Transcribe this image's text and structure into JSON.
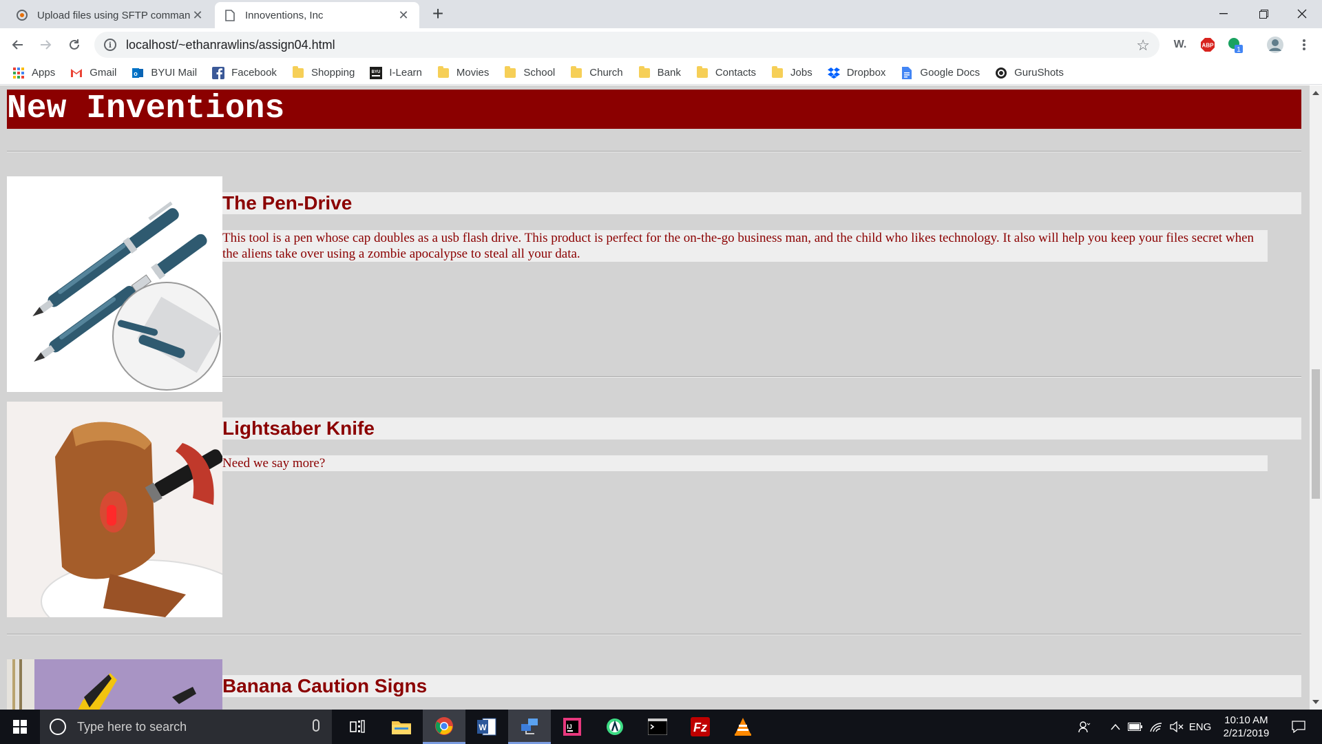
{
  "browser": {
    "tabs": [
      {
        "title": "Upload files using SFTP comman",
        "active": false,
        "icon": "sftp-favicon"
      },
      {
        "title": "Innoventions, Inc",
        "active": true,
        "icon": "page-icon"
      }
    ],
    "new_tab_label": "+",
    "url": "localhost/~ethanrawlins/assign04.html",
    "extensions": [
      "w-extension-icon",
      "adblock-plus-icon",
      "green-extension-icon",
      "profile-avatar"
    ],
    "extension_labels": {
      "w": "W.",
      "abp": "ABP",
      "badge": "1"
    },
    "window_controls": [
      "minimize",
      "restore",
      "close"
    ]
  },
  "bookmarks": [
    {
      "label": "Apps",
      "icon": "apps-grid-icon"
    },
    {
      "label": "Gmail",
      "icon": "gmail-icon"
    },
    {
      "label": "BYUI Mail",
      "icon": "outlook-icon"
    },
    {
      "label": "Facebook",
      "icon": "facebook-icon"
    },
    {
      "label": "Shopping",
      "icon": "folder-icon"
    },
    {
      "label": "I-Learn",
      "icon": "byui-icon"
    },
    {
      "label": "Movies",
      "icon": "folder-icon"
    },
    {
      "label": "School",
      "icon": "folder-icon"
    },
    {
      "label": "Church",
      "icon": "folder-icon"
    },
    {
      "label": "Bank",
      "icon": "folder-icon"
    },
    {
      "label": "Contacts",
      "icon": "folder-icon"
    },
    {
      "label": "Jobs",
      "icon": "folder-icon"
    },
    {
      "label": "Dropbox",
      "icon": "dropbox-icon"
    },
    {
      "label": "Google Docs",
      "icon": "google-docs-icon"
    },
    {
      "label": "GuruShots",
      "icon": "gurushots-icon"
    }
  ],
  "page": {
    "title": "New Inventions",
    "colors": {
      "header_bg": "#8b0000",
      "text": "#8b0000",
      "page_bg": "#d3d3d3",
      "box_bg": "#eeeeee"
    },
    "products": [
      {
        "name": "The Pen-Drive",
        "description": "This tool is a pen whose cap doubles as a usb flash drive. This product is perfect for the on-the-go business man, and the child who likes technology. It also will help you keep your files secret when the aliens take over using a zombie apocalypse to steal all your data.",
        "image": "pen-drive-photo"
      },
      {
        "name": "Lightsaber Knife",
        "description": "Need we say more?",
        "image": "lightsaber-knife-photo"
      },
      {
        "name": "Banana Caution Signs",
        "description": "",
        "image": "banana-caution-sign-photo"
      }
    ]
  },
  "taskbar": {
    "search_placeholder": "Type here to search",
    "apps": [
      "task-view",
      "file-explorer",
      "chrome",
      "word",
      "network-app",
      "intellij",
      "android-studio",
      "terminal",
      "filezilla",
      "vlc"
    ],
    "language": "ENG",
    "time": "10:10 AM",
    "date": "2/21/2019"
  }
}
